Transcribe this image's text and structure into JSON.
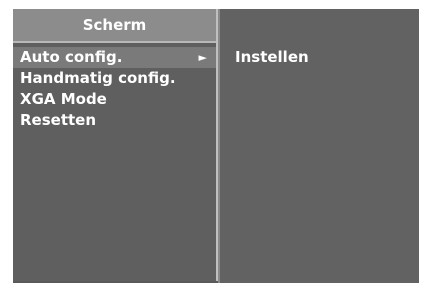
{
  "menu": {
    "title": "Scherm",
    "items": [
      {
        "label": "Auto config.",
        "selected": true,
        "has_submenu": true
      },
      {
        "label": "Handmatig config.",
        "selected": false
      },
      {
        "label": "XGA Mode",
        "selected": false
      },
      {
        "label": "Resetten",
        "selected": false
      }
    ],
    "submenu_arrow": "►"
  },
  "submenu": {
    "items": [
      {
        "label": "Instellen"
      }
    ]
  },
  "colors": {
    "panel_bg": "#5f5f5f",
    "header_bg": "#8c8c8c",
    "selected_bg": "#7a7a7a",
    "text": "#ffffff"
  }
}
